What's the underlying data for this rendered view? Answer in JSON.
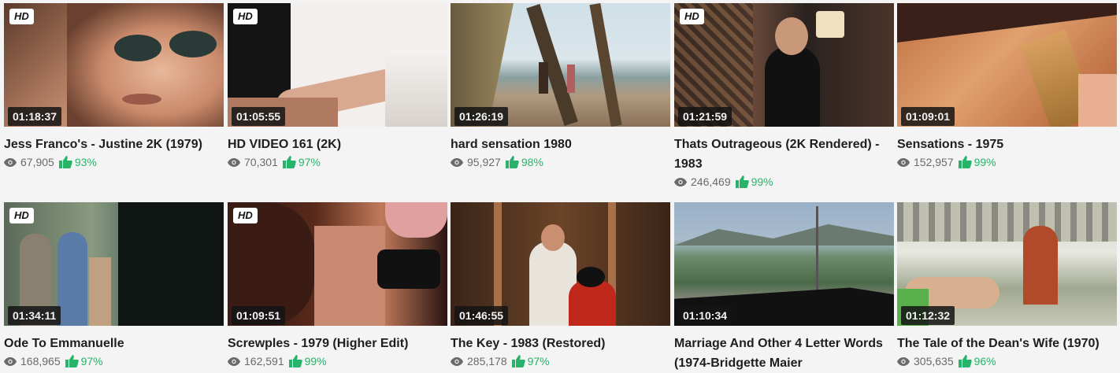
{
  "videos": [
    {
      "title": "Jess Franco's - Justine 2K (1979)",
      "duration": "01:18:37",
      "views": "67,905",
      "rating": "93%",
      "hd": "HD"
    },
    {
      "title": "HD VIDEO 161 (2K)",
      "duration": "01:05:55",
      "views": "70,301",
      "rating": "97%",
      "hd": "HD"
    },
    {
      "title": "hard sensation 1980",
      "duration": "01:26:19",
      "views": "95,927",
      "rating": "98%",
      "hd": ""
    },
    {
      "title": "Thats Outrageous (2K Rendered) - 1983",
      "duration": "01:21:59",
      "views": "246,469",
      "rating": "99%",
      "hd": "HD"
    },
    {
      "title": "Sensations - 1975",
      "duration": "01:09:01",
      "views": "152,957",
      "rating": "99%",
      "hd": ""
    },
    {
      "title": "Ode To Emmanuelle",
      "duration": "01:34:11",
      "views": "168,965",
      "rating": "97%",
      "hd": "HD"
    },
    {
      "title": "Screwples - 1979 (Higher Edit)",
      "duration": "01:09:51",
      "views": "162,591",
      "rating": "99%",
      "hd": "HD"
    },
    {
      "title": "The Key - 1983 (Restored)",
      "duration": "01:46:55",
      "views": "285,178",
      "rating": "97%",
      "hd": ""
    },
    {
      "title": "Marriage And Other 4 Letter Words (1974-Bridgette Maier",
      "duration": "01:10:34",
      "views": "",
      "rating": "",
      "hd": ""
    },
    {
      "title": "The Tale of the Dean's Wife (1970)",
      "duration": "01:12:32",
      "views": "305,635",
      "rating": "96%",
      "hd": ""
    }
  ],
  "colors": {
    "accent_green": "#27b36a",
    "duration_bg": "#1a1a1a",
    "page_bg": "#f4f4f4"
  },
  "icons": {
    "views": "eye-icon",
    "rating": "thumbs-up-icon"
  }
}
